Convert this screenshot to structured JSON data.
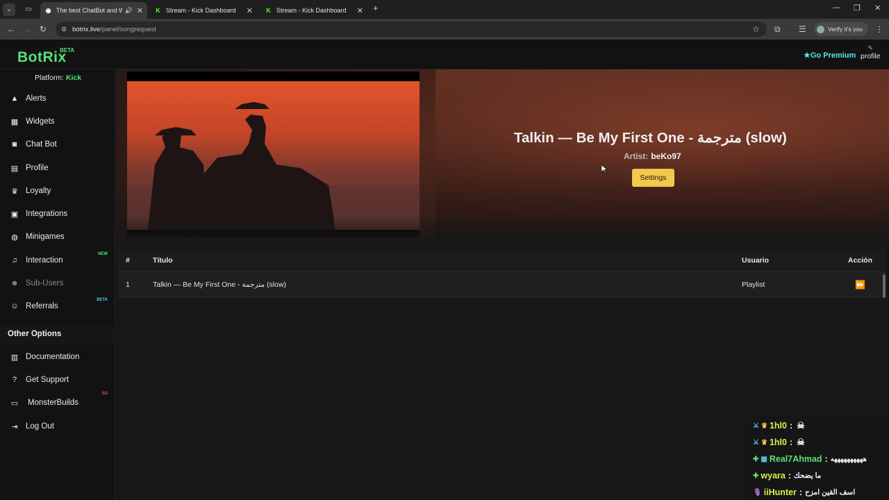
{
  "browser": {
    "tabs": [
      {
        "title": "The best ChatBot and Widg",
        "active": true,
        "favicon": "botrix-favicon-icon"
      },
      {
        "title": "Stream - Kick Dashboard",
        "active": false,
        "favicon": "kick-favicon-icon"
      },
      {
        "title": "Stream - Kick Dashboard",
        "active": false,
        "favicon": "kick-favicon-icon"
      }
    ],
    "url_host": "botrix.live",
    "url_path": "/panel/songrequest",
    "profile_label": "Verify it's you"
  },
  "header": {
    "logo": "BotRix",
    "logo_badge": "BETA",
    "premium": "Go Premium",
    "profile": "profile"
  },
  "sidebar": {
    "platform_label": "Platform:",
    "platform_value": "Kick",
    "items": [
      {
        "label": "Alerts",
        "icon": "warning-icon"
      },
      {
        "label": "Widgets",
        "icon": "widgets-grid-icon"
      },
      {
        "label": "Chat Bot",
        "icon": "robot-icon"
      },
      {
        "label": "Profile",
        "icon": "id-card-icon"
      },
      {
        "label": "Loyalty",
        "icon": "trophy-icon"
      },
      {
        "label": "Integrations",
        "icon": "integrations-icon"
      },
      {
        "label": "Minigames",
        "icon": "gamepad-icon"
      },
      {
        "label": "Interaction",
        "icon": "music-note-icon",
        "badge": "NEW"
      },
      {
        "label": "Sub-Users",
        "icon": "sub-users-icon",
        "disabled": true
      },
      {
        "label": "Referrals",
        "icon": "users-icon",
        "badge": "BETA"
      }
    ],
    "other_title": "Other Options",
    "other_items": [
      {
        "label": "Documentation",
        "icon": "book-icon"
      },
      {
        "label": "Get Support",
        "icon": "question-icon"
      },
      {
        "label": "MonsterBuilds",
        "icon": "laptop-icon",
        "badge": "AD"
      },
      {
        "label": "Log Out",
        "icon": "logout-icon"
      }
    ]
  },
  "now_playing": {
    "title": "Talkin — Be My First One - مترجمة (slow)",
    "artist_label": "Artist:",
    "artist": "beKo97",
    "settings_button": "Settings"
  },
  "queue": {
    "columns": [
      "#",
      "Título",
      "Usuario",
      "Acción"
    ],
    "rows": [
      {
        "num": "1",
        "title": "Talkin — Be My First One - مترجمة (slow)",
        "user": "Playlist",
        "action_icon": "skip-forward-icon"
      }
    ]
  },
  "chat_overlay": {
    "messages": [
      {
        "user": "1hl0",
        "separator": ":",
        "text": "",
        "color": "#d8f04c"
      },
      {
        "user": "1hl0",
        "separator": ":",
        "text": "",
        "color": "#d8f04c"
      },
      {
        "user": "Real7Ahmad",
        "separator": ":",
        "text": "ههههههههههه",
        "color": "#53e37a"
      },
      {
        "user": "wyara",
        "separator": ":",
        "text": "ما يضحك",
        "color": "#d8f04c"
      },
      {
        "user": "iiHunter",
        "separator": ":",
        "text": "اسف القين امزح",
        "color": "#d8f04c"
      }
    ]
  },
  "colors": {
    "brand_green": "#53e37a",
    "premium_cyan": "#55e6e6",
    "settings_yellow": "#f2c94c"
  }
}
